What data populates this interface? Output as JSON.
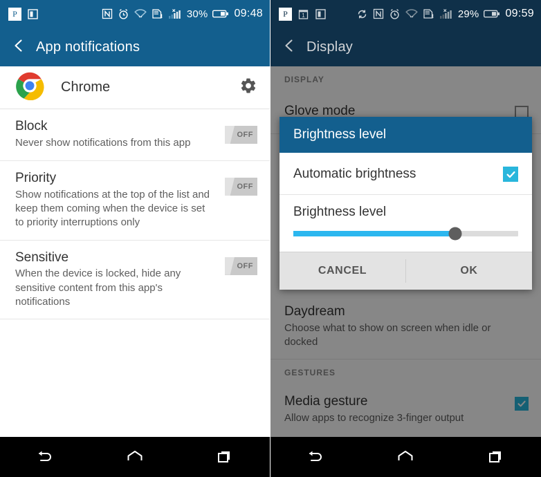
{
  "left_phone": {
    "status_bar": {
      "left_icons": [
        "pocket-badge-icon",
        "flipboard-icon"
      ],
      "right_icons": [
        "nfc-icon",
        "alarm-icon",
        "wifi-icon",
        "sd-card-warning-icon",
        "signal-bars-icon"
      ],
      "battery_percent": "30%",
      "time": "09:48"
    },
    "app_bar": {
      "back_icon": "back-chevron-icon",
      "title": "App notifications"
    },
    "app_row": {
      "icon": "chrome-logo-icon",
      "label": "Chrome",
      "action_icon": "gear-icon"
    },
    "settings": [
      {
        "title": "Block",
        "desc": "Never show notifications from this app",
        "switch_label": "OFF",
        "switch_state": "off"
      },
      {
        "title": "Priority",
        "desc": "Show notifications at the top of the list and keep them coming when the device is set to priority interruptions only",
        "switch_label": "OFF",
        "switch_state": "off"
      },
      {
        "title": "Sensitive",
        "desc": "When the device is locked, hide any sensitive content from this app's notifications",
        "switch_label": "OFF",
        "switch_state": "off"
      }
    ],
    "nav_bar": {
      "back": "back-icon",
      "home": "home-icon",
      "recents": "recents-icon"
    }
  },
  "right_phone": {
    "status_bar": {
      "left_icons": [
        "pocket-badge-icon",
        "calendar-icon",
        "flipboard-icon"
      ],
      "right_icons": [
        "sync-icon",
        "nfc-icon",
        "alarm-icon",
        "wifi-icon",
        "sd-card-warning-icon",
        "signal-bars-icon"
      ],
      "battery_percent": "29%",
      "time": "09:59"
    },
    "app_bar": {
      "back_icon": "back-chevron-icon",
      "title": "Display"
    },
    "sections": [
      {
        "header": "DISPLAY"
      }
    ],
    "rows": [
      {
        "title": "Glove mode",
        "desc": "",
        "checkbox": "unchecked"
      },
      {
        "title": "Daydream",
        "desc": "Choose what to show on screen when idle or docked",
        "checkbox": "none"
      }
    ],
    "gestures_header": "GESTURES",
    "gestures_rows": [
      {
        "title": "Media gesture",
        "desc": "Allow apps to recognize 3-finger output",
        "checkbox": "checked"
      }
    ],
    "dialog": {
      "title": "Brightness level",
      "auto_option_label": "Automatic brightness",
      "auto_option_checked": true,
      "slider_label": "Brightness level",
      "slider_percent": 72,
      "cancel_label": "CANCEL",
      "ok_label": "OK"
    },
    "nav_bar": {
      "back": "back-icon",
      "home": "home-icon",
      "recents": "recents-icon"
    }
  },
  "colors": {
    "app_bar_blue": "#135f8e",
    "app_bar_dark": "#0f3049",
    "accent_cyan": "#2cb7ef",
    "checkbox_cyan": "#29b6dc",
    "switch_track": "#c9c9c9",
    "nav_bar": "#000000"
  }
}
